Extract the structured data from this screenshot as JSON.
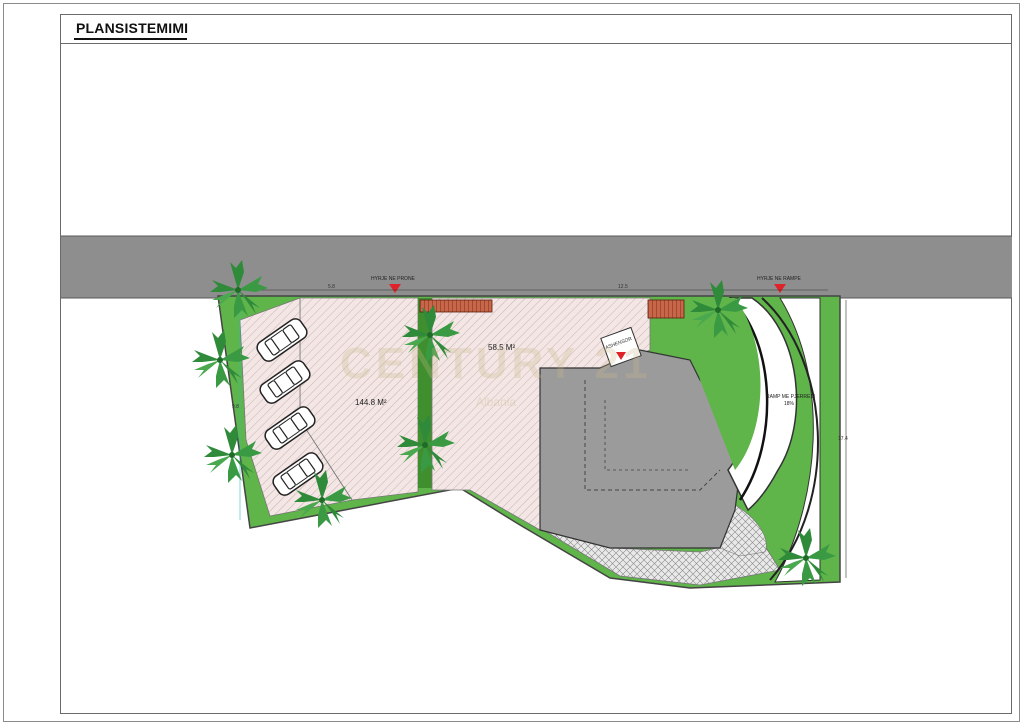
{
  "sheet": {
    "title": "PLANSISTEMIMI"
  },
  "plan": {
    "labels": {
      "entrance_left": "HYRJE NE PRONE",
      "entrance_right": "HYRJE NE RAMPE",
      "area_left": "144.8 M²",
      "area_mid": "58.5 M²",
      "ramp": "RAMP ME PJERRESI",
      "ramp_pct": "18%",
      "dim_top_left": "5.8",
      "dim_top_right": "12.5",
      "dim_side_right": "17.4",
      "dim_left": "9.8",
      "elevator_label": "ASHENSOR"
    },
    "watermark": {
      "brand": "CENTURY 21",
      "sub": "Albania"
    },
    "colors": {
      "road": "#8e8e8e",
      "grass": "#5fb44a",
      "grass_dark": "#3f8f2f",
      "paving": "#efe3e1",
      "building": "#9b9b9b",
      "stairs": "#b3563d",
      "marker": "#e0232b"
    }
  }
}
